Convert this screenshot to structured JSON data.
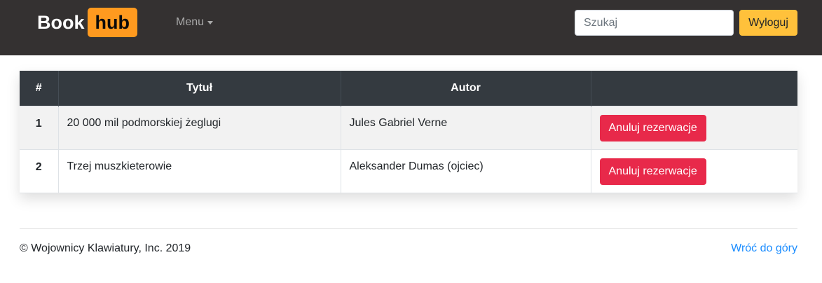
{
  "navbar": {
    "brand_part1": "Book",
    "brand_part2": "hub",
    "menu_label": "Menu",
    "search_placeholder": "Szukaj",
    "logout_label": "Wyloguj"
  },
  "table": {
    "headers": [
      "#",
      "Tytuł",
      "Autor",
      ""
    ],
    "rows": [
      {
        "num": "1",
        "title": "20 000 mil podmorskiej żeglugi",
        "author": "Jules Gabriel Verne",
        "action": "Anuluj rezerwacje"
      },
      {
        "num": "2",
        "title": "Trzej muszkieterowie",
        "author": "Aleksander Dumas (ojciec)",
        "action": "Anuluj rezerwacje"
      }
    ]
  },
  "footer": {
    "copyright": "© Wojownicy Klawiatury, Inc. 2019",
    "back_to_top": "Wróć do góry"
  },
  "colors": {
    "navbar_bg": "#343131",
    "brand_accent": "#ff9a1f",
    "logout_button": "#ffc13b",
    "table_header": "#343a40",
    "cancel_button": "#e8294a",
    "link": "#1a8cff"
  }
}
